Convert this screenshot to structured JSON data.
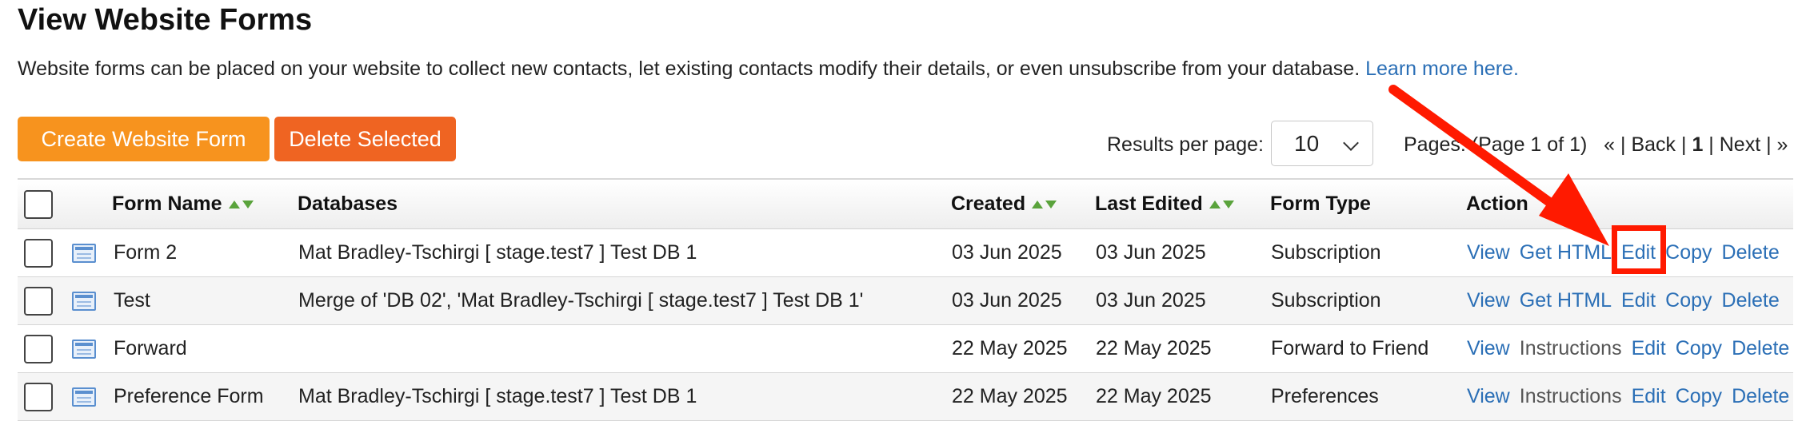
{
  "page": {
    "title": "View Website Forms",
    "intro_text": "Website forms can be placed on your website to collect new contacts, let existing contacts modify their details, or even unsubscribe from your database.",
    "learn_more": "Learn more here."
  },
  "toolbar": {
    "create_label": "Create Website Form",
    "delete_label": "Delete Selected",
    "results_label": "Results per page:",
    "results_value": "10",
    "pages_text": "Pages: (Page 1 of 1)",
    "first": "«",
    "back": "Back",
    "current_page": "1",
    "next": "Next",
    "last": "»"
  },
  "table": {
    "headers": {
      "form_name": "Form Name",
      "databases": "Databases",
      "created": "Created",
      "last_edited": "Last Edited",
      "form_type": "Form Type",
      "action": "Action"
    },
    "rows": [
      {
        "name": "Form 2",
        "databases": "Mat Bradley-Tschirgi [ stage.test7 ] Test DB 1",
        "created": "03 Jun 2025",
        "edited": "03 Jun 2025",
        "type": "Subscription",
        "actions": [
          "View",
          "Get HTML",
          "Edit",
          "Copy",
          "Delete"
        ]
      },
      {
        "name": "Test",
        "databases": "Merge of 'DB 02', 'Mat Bradley-Tschirgi [ stage.test7 ] Test DB 1'",
        "created": "03 Jun 2025",
        "edited": "03 Jun 2025",
        "type": "Subscription",
        "actions": [
          "View",
          "Get HTML",
          "Edit",
          "Copy",
          "Delete"
        ]
      },
      {
        "name": "Forward",
        "databases": "",
        "created": "22 May 2025",
        "edited": "22 May 2025",
        "type": "Forward to Friend",
        "actions": [
          "View",
          "Instructions",
          "Edit",
          "Copy",
          "Delete"
        ]
      },
      {
        "name": "Preference Form",
        "databases": "Mat Bradley-Tschirgi [ stage.test7 ] Test DB 1",
        "created": "22 May 2025",
        "edited": "22 May 2025",
        "type": "Preferences",
        "actions": [
          "View",
          "Instructions",
          "Edit",
          "Copy",
          "Delete"
        ]
      }
    ]
  },
  "colors": {
    "create_button": "#f7931e",
    "delete_button": "#ef6422",
    "link": "#2b6fb6",
    "annotation": "#ff1a00"
  },
  "icons": [
    "form-icon",
    "sort-arrows-icon",
    "chevron-down-icon",
    "annotation-arrow"
  ]
}
